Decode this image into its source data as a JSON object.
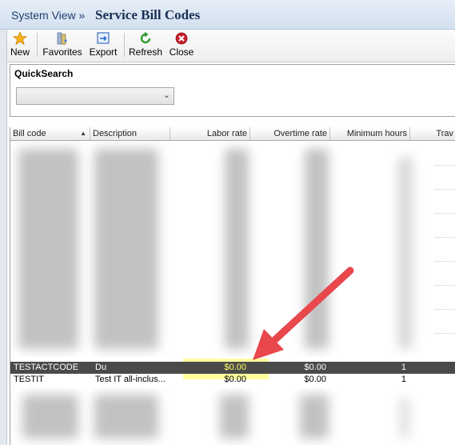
{
  "header": {
    "breadcrumb": "System View »",
    "title": "Service Bill Codes"
  },
  "toolbar": {
    "new_label": "New",
    "favorites_label": "Favorites",
    "export_label": "Export",
    "refresh_label": "Refresh",
    "close_label": "Close"
  },
  "quicksearch": {
    "label": "QuickSearch",
    "value": ""
  },
  "grid": {
    "columns": [
      "Bill code",
      "Description",
      "Labor rate",
      "Overtime rate",
      "Minimum hours",
      "Trav"
    ],
    "rows": [
      {
        "code": "TESTACTCODE",
        "description": "Du",
        "labor_rate": "$0.00",
        "overtime_rate": "$0.00",
        "minimum_hours": "1"
      },
      {
        "code": "TESTIT",
        "description": "Test IT all-inclus...",
        "labor_rate": "$0.00",
        "overtime_rate": "$0.00",
        "minimum_hours": "1"
      }
    ]
  },
  "colors": {
    "annotation_arrow": "#e8474c",
    "highlight": "#ffff3c",
    "selected_row": "#4a4a4a"
  },
  "icons": [
    "star-icon",
    "favorites-icon",
    "export-icon",
    "refresh-icon",
    "close-icon",
    "chevron-down-icon",
    "sort-ascending-icon"
  ]
}
